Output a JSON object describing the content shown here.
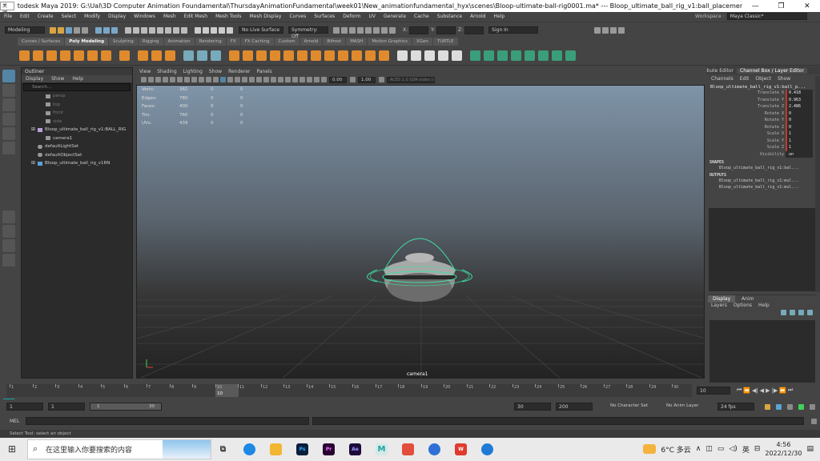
{
  "titlebar": {
    "close_tag": "关闭",
    "title": "todesk Maya 2019: G:\\Ual\\3D Computer Animation Foundamental\\ThursdayAnimationFundamental\\week01\\New_animationfundamental_hyx\\scenes\\Bloop-ultimate-ball-rig0001.ma*  ---  Bloop_ultimate_ball_rig_v1:ball_placement_..."
  },
  "menubar": {
    "items": [
      "File",
      "Edit",
      "Create",
      "Select",
      "Modify",
      "Display",
      "Windows",
      "Mesh",
      "Edit Mesh",
      "Mesh Tools",
      "Mesh Display",
      "Curves",
      "Surfaces",
      "Deform",
      "UV",
      "Generate",
      "Cache",
      "Substance",
      "Arnold",
      "Help"
    ],
    "workspace_label": "Workspace :",
    "workspace_value": "Maya Classic*"
  },
  "statusline": {
    "mode": "Modeling",
    "live_surface": "No Live Surface",
    "symmetry": "Symmetry: Off",
    "sign_in": "Sign In",
    "x_label": "X:",
    "y_label": "Y:",
    "z_label": "Z:"
  },
  "shelf": {
    "tabs": [
      "Curves / Surfaces",
      "Poly Modeling",
      "Sculpting",
      "Rigging",
      "Animation",
      "Rendering",
      "FX",
      "FX Caching",
      "Custom",
      "Arnold",
      "Bifrost",
      "MASH",
      "Motion Graphics",
      "XGen",
      "TURTLE"
    ],
    "active_tab": "Poly Modeling"
  },
  "outliner": {
    "title": "Outliner",
    "menu": [
      "Display",
      "Show",
      "Help"
    ],
    "search_placeholder": "Search...",
    "items": [
      {
        "label": "persp",
        "dim": true
      },
      {
        "label": "top",
        "dim": true
      },
      {
        "label": "front",
        "dim": true
      },
      {
        "label": "side",
        "dim": true
      },
      {
        "label": "Bloop_ultimate_ball_rig_v1:BALL_RIG",
        "dim": false
      },
      {
        "label": "camera1",
        "dim": false
      },
      {
        "label": "defaultLightSet",
        "dim": false
      },
      {
        "label": "defaultObjectSet",
        "dim": false
      },
      {
        "label": "Bloop_ultimate_ball_rig_v1RN",
        "dim": false
      }
    ]
  },
  "viewport": {
    "menu": [
      "View",
      "Shading",
      "Lighting",
      "Show",
      "Renderer",
      "Panels"
    ],
    "exposure": "0.00",
    "gamma": "1.00",
    "color_space": "ACES 1.0 SDR-video (sRGB)",
    "hud": [
      {
        "label": "Verts:",
        "a": "382",
        "b": "0",
        "c": "0"
      },
      {
        "label": "Edges:",
        "a": "780",
        "b": "0",
        "c": "0"
      },
      {
        "label": "Faces:",
        "a": "400",
        "b": "0",
        "c": "0"
      },
      {
        "label": "Tris:",
        "a": "760",
        "b": "0",
        "c": "0"
      },
      {
        "label": "UVs:",
        "a": "439",
        "b": "0",
        "c": "0"
      }
    ],
    "camera_label": "camera1"
  },
  "channelbox": {
    "tabs": [
      "Attribute Editor",
      "Channel Box / Layer Editor"
    ],
    "menu": [
      "Channels",
      "Edit",
      "Object",
      "Show"
    ],
    "object": "Bloop_ultimate_ball_rig_v1:ball_p...",
    "channels": [
      {
        "label": "Translate X",
        "value": "0.418",
        "keyed": true
      },
      {
        "label": "Translate Y",
        "value": "0.963",
        "keyed": true
      },
      {
        "label": "Translate Z",
        "value": "2.486",
        "keyed": true
      },
      {
        "label": "Rotate X",
        "value": "0",
        "keyed": true
      },
      {
        "label": "Rotate Y",
        "value": "0",
        "keyed": true
      },
      {
        "label": "Rotate Z",
        "value": "0",
        "keyed": true
      },
      {
        "label": "Scale X",
        "value": "1",
        "keyed": true
      },
      {
        "label": "Scale Y",
        "value": "1",
        "keyed": true
      },
      {
        "label": "Scale Z",
        "value": "1",
        "keyed": true
      },
      {
        "label": "Visibility",
        "value": "on",
        "keyed": false
      }
    ],
    "shapes_label": "SHAPES",
    "shape_item": "Bloop_ultimate_ball_rig_v1:bal...",
    "outputs_label": "OUTPUTS",
    "output_items": [
      "Bloop_ultimate_ball_rig_v1:mul...",
      "Bloop_ultimate_ball_rig_v1:mul..."
    ]
  },
  "layer_editor": {
    "tabs": [
      "Display",
      "Anim"
    ],
    "menu": [
      "Layers",
      "Options",
      "Help"
    ]
  },
  "timeslider": {
    "ticks": [
      "1",
      "2",
      "3",
      "4",
      "5",
      "6",
      "7",
      "8",
      "9",
      "10",
      "11",
      "12",
      "13",
      "14",
      "15",
      "16",
      "17",
      "18",
      "19",
      "20",
      "21",
      "22",
      "23",
      "24",
      "25",
      "26",
      "27",
      "28",
      "29",
      "30"
    ],
    "current_frame": "10",
    "current_frame_field": "10"
  },
  "range": {
    "start": "1",
    "start_inner": "1",
    "bar_start": "1",
    "bar_end": "30",
    "end_inner": "30",
    "end": "200",
    "char_set": "No Character Set",
    "anim_layer": "No Anim Layer",
    "fps": "24 fps"
  },
  "mel": {
    "label": "MEL"
  },
  "helpline": {
    "text": "Select Tool: select an object"
  },
  "taskbar": {
    "search_placeholder": "在这里输入你要搜索的内容",
    "weather": "6°C 多云",
    "ime": "英",
    "time": "4:56",
    "date": "2022/12/30"
  }
}
